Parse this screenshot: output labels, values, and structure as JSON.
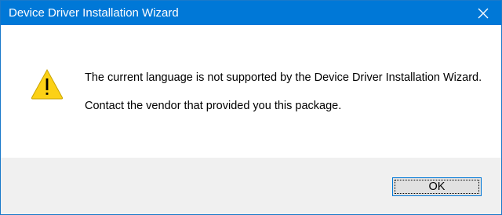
{
  "window": {
    "title": "Device Driver Installation Wizard",
    "close_icon": "close-icon",
    "colors": {
      "titlebar": "#0078d7",
      "footer": "#f0f0f0",
      "button": "#e1e1e1",
      "warning": "#fcd116"
    }
  },
  "message": {
    "icon": "warning-icon",
    "line1": "The current language is not supported by the Device Driver Installation Wizard.",
    "line2": "Contact the vendor that provided you this package."
  },
  "buttons": {
    "ok_label": "OK"
  }
}
